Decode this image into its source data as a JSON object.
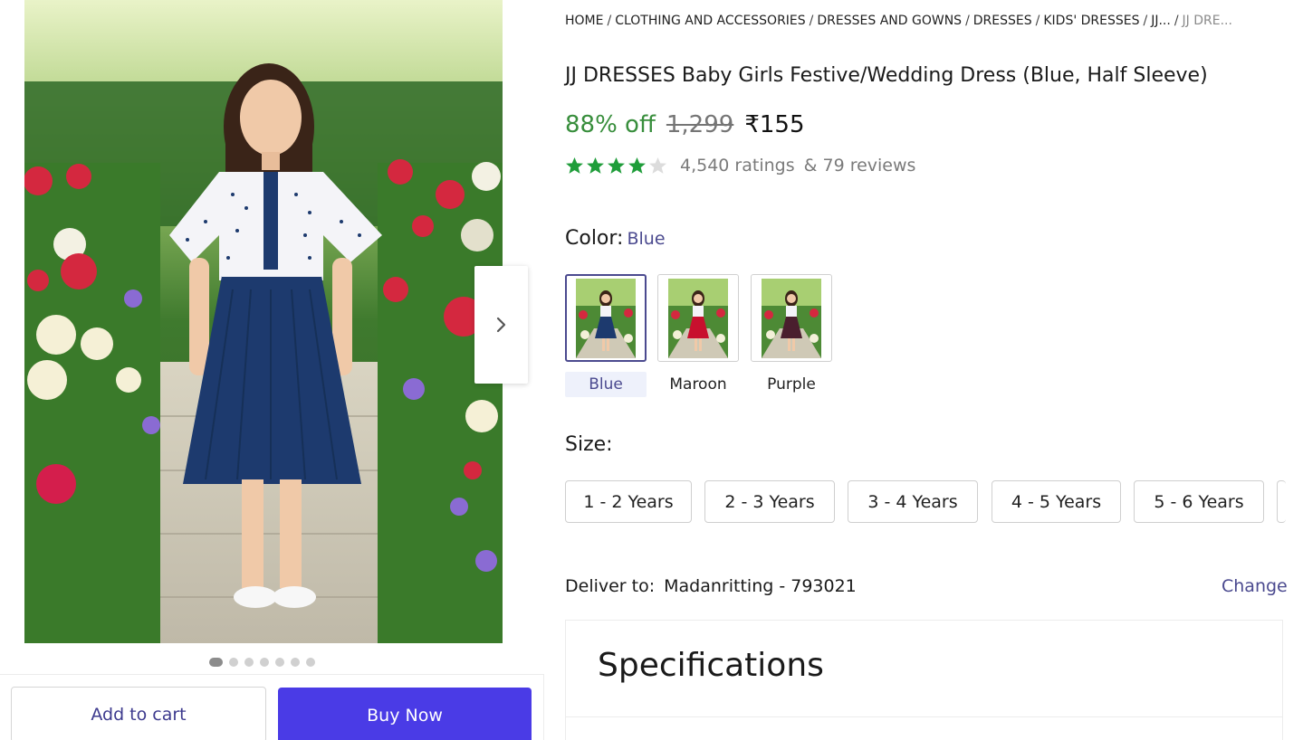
{
  "gallery": {
    "image_alt": "Girl wearing blue festive dress standing in garden",
    "dot_count": 7,
    "active_dot": 0
  },
  "breadcrumb": {
    "items": [
      "HOME",
      "CLOTHING AND ACCESSORIES",
      "DRESSES AND GOWNS",
      "DRESSES",
      "KIDS' DRESSES",
      "JJ..."
    ],
    "separator": "/",
    "current": "JJ DRE..."
  },
  "product": {
    "title": "JJ DRESSES Baby Girls Festive/Wedding Dress (Blue, Half Sleeve)",
    "discount": "88% off",
    "mrp": "1,299",
    "price": "₹155",
    "rating_value": 4,
    "ratings_text": "4,540 ratings",
    "reviews_text": "& 79 reviews"
  },
  "color": {
    "label": "Color:",
    "selected": "Blue",
    "options": [
      {
        "label": "Blue",
        "skirt": "#1d3a6e"
      },
      {
        "label": "Maroon",
        "skirt": "#c8102e"
      },
      {
        "label": "Purple",
        "skirt": "#4a1f2e"
      }
    ]
  },
  "size": {
    "label": "Size:",
    "options": [
      "1 - 2 Years",
      "2 - 3 Years",
      "3 - 4 Years",
      "4 - 5 Years",
      "5 - 6 Years"
    ]
  },
  "delivery": {
    "label": "Deliver to:",
    "location": "Madanritting - 793021",
    "change_label": "Change"
  },
  "specs": {
    "title": "Specifications"
  },
  "actions": {
    "add_to_cart": "Add to cart",
    "buy_now": "Buy Now"
  },
  "colors": {
    "accent": "#4b4a8f",
    "buy": "#4a3be6",
    "discount": "#388e3c",
    "star": "#1f9d3a"
  }
}
